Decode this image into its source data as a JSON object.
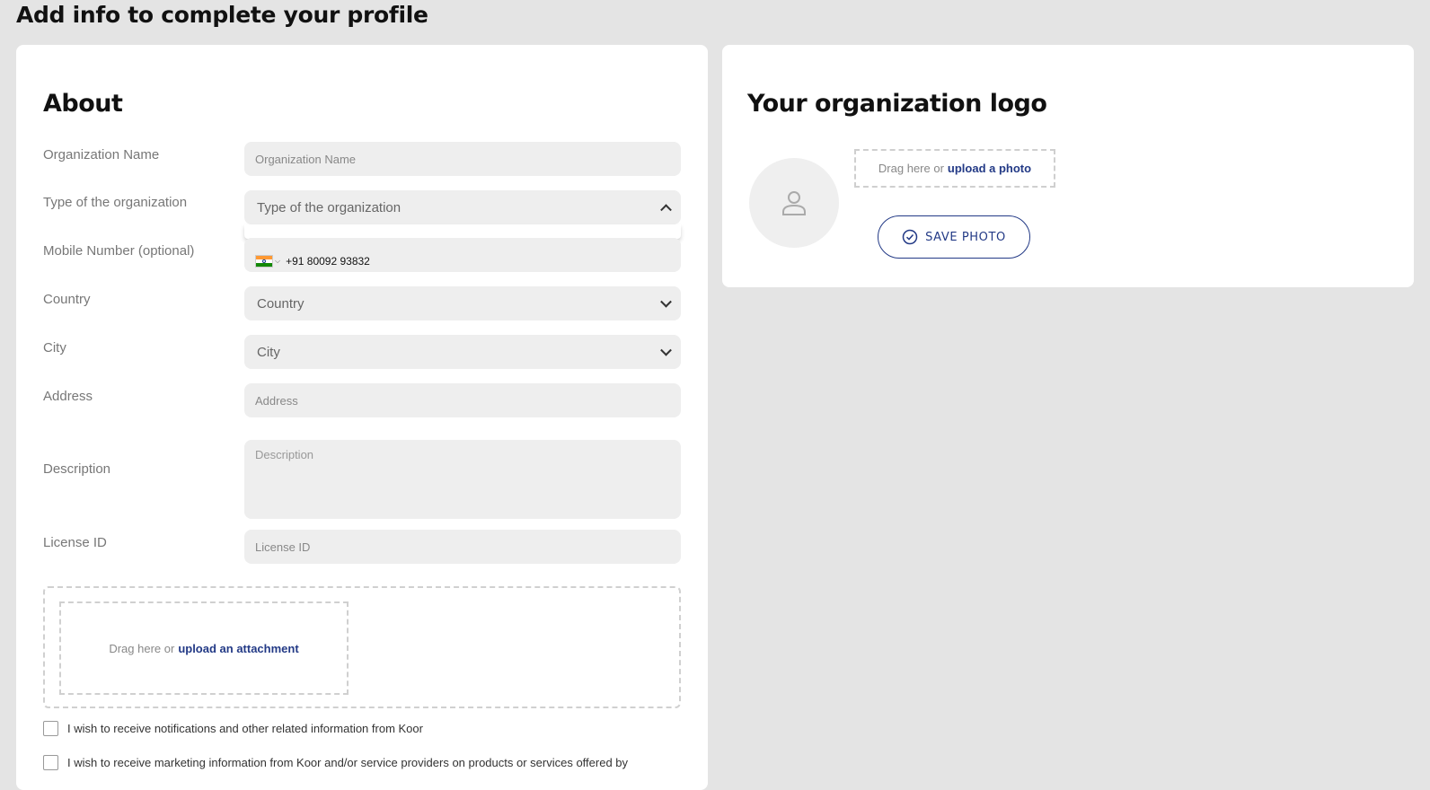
{
  "page": {
    "title": "Add info to complete your profile"
  },
  "about": {
    "title": "About",
    "org_name": {
      "label": "Organization Name",
      "placeholder": "Organization Name"
    },
    "org_type": {
      "label": "Type of the organization",
      "placeholder": "Type of the organization"
    },
    "mobile": {
      "label": "Mobile Number (optional)",
      "value": "+91 80092 93832",
      "flag": "india-flag-icon"
    },
    "country": {
      "label": "Country",
      "placeholder": "Country"
    },
    "city": {
      "label": "City",
      "placeholder": "City"
    },
    "address": {
      "label": "Address",
      "placeholder": "Address"
    },
    "description": {
      "label": "Description",
      "placeholder": "Description"
    },
    "license": {
      "label": "License ID",
      "placeholder": "License ID"
    },
    "attachment": {
      "prefix": "Drag here or",
      "link": "upload an attachment"
    },
    "consents": [
      "I wish to receive notifications and other related information from Koor",
      "I wish to receive marketing information from Koor and/or service providers on products or services offered by"
    ]
  },
  "logo": {
    "title": "Your organization logo",
    "drop_prefix": "Drag here or",
    "drop_link": "upload a photo",
    "save_label": "SAVE PHOTO"
  },
  "colors": {
    "accent": "#233a86",
    "background": "#e4e4e4",
    "field": "#eeeeee"
  }
}
